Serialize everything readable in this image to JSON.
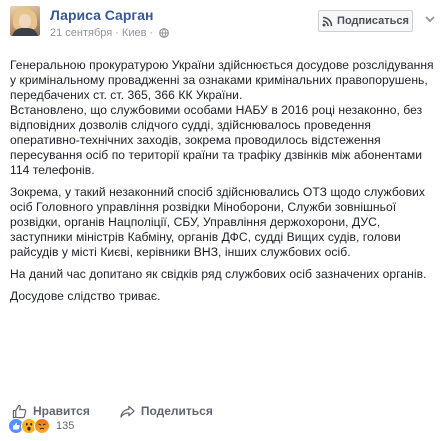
{
  "post": {
    "author_name": "Лариса Сарган",
    "date": "21 сентября",
    "dot": "·",
    "location": "Киев",
    "audience_icon": "globe-icon",
    "follow_label": "Подписаться",
    "follow_icon": "rss-icon",
    "menu_icon": "chevron-down-icon",
    "paragraphs": [
      "Генеральною прокуратурою України здійснюється досудове розслідування у кримінальному провадженні за ознаками кримінальних правопорушень, передбачених ст. ст. 365, 366 КК України.",
      "Встановлено, що службовими особами НАБУ в 2016 році незаконно, без відповідних дозволів слідчого судді, здійснювалось проведення оперативно-технічних заходів, зокрема проводилось відстеження пересування осіб по території країни та трафіку дзвінків між абонентами 114 телефонів.",
      "Зокрема, у такий незаконний спосіб здійснювались ОТЗ щодо службових осіб Головного управління розвідки Міноборони, Служби зовнішньої розвідки, органів Нацполіції, СБУ, Управління держохорони, ДУС, заступники міністрів Кабміну, органів ДФС, судді Вищих судів, голови райсудів у місті Києві, керівники ВНЗ, інших службових осіб.",
      "На даний час допитано як свідків ряд службових осіб зазначених органів.",
      "Досудове слідство триває."
    ]
  },
  "actions": {
    "like_label": "Нравится",
    "like_icon": "thumbs-up-icon",
    "share_label": "Поделиться",
    "share_icon": "share-arrow-icon"
  },
  "reactions": {
    "icons": [
      "like-reaction-icon",
      "wow-reaction-icon",
      "angry-reaction-icon"
    ],
    "count": "135"
  },
  "colors": {
    "author": "#365899",
    "meta": "#90949c",
    "text": "#1d2129",
    "action": "#616770",
    "like_blue": "#5890ff",
    "wow_yellow": "#f7b125"
  }
}
